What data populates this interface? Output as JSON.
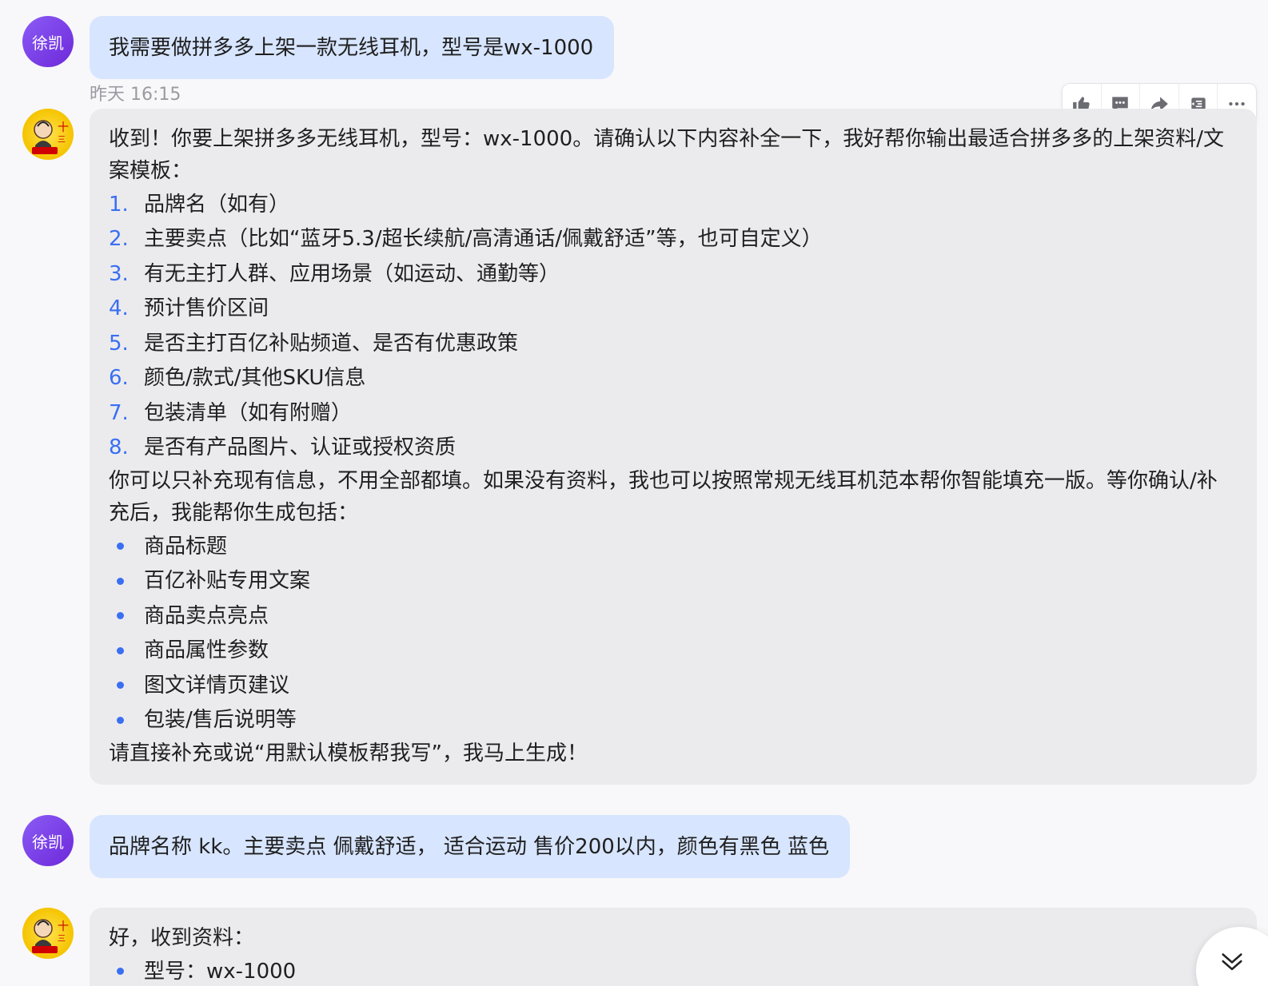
{
  "messages": {
    "m1": {
      "sender": "徐凯",
      "text": "我需要做拼多多上架一款无线耳机，型号是wx-1000"
    },
    "timestamp": "昨天 16:15",
    "m2": {
      "intro": "收到！你要上架拼多多无线耳机，型号：wx-1000。请确认以下内容补全一下，我好帮你输出最适合拼多多的上架资料/文案模板：",
      "numbered": [
        {
          "n": "1.",
          "t": "品牌名（如有）"
        },
        {
          "n": "2.",
          "t": "主要卖点（比如“蓝牙5.3/超长续航/高清通话/佩戴舒适”等，也可自定义）"
        },
        {
          "n": "3.",
          "t": "有无主打人群、应用场景（如运动、通勤等）"
        },
        {
          "n": "4.",
          "t": "预计售价区间"
        },
        {
          "n": "5.",
          "t": "是否主打百亿补贴频道、是否有优惠政策"
        },
        {
          "n": "6.",
          "t": "颜色/款式/其他SKU信息"
        },
        {
          "n": "7.",
          "t": "包装清单（如有附赠）"
        },
        {
          "n": "8.",
          "t": "是否有产品图片、认证或授权资质"
        }
      ],
      "middle": "你可以只补充现有信息，不用全部都填。如果没有资料，我也可以按照常规无线耳机范本帮你智能填充一版。等你确认/补充后，我能帮你生成包括：",
      "bullets": [
        "商品标题",
        "百亿补贴专用文案",
        "商品卖点亮点",
        "商品属性参数",
        "图文详情页建议",
        "包装/售后说明等"
      ],
      "outro": "请直接补充或说“用默认模板帮我写”，我马上生成！"
    },
    "m3": {
      "sender": "徐凯",
      "text": "品牌名称 kk。主要卖点 佩戴舒适， 适合运动 售价200以内，颜色有黑色 蓝色"
    },
    "m4": {
      "intro": "好，收到资料：",
      "bullets": [
        "型号：wx-1000"
      ]
    }
  },
  "toolbar": {
    "icons": [
      "thumbs-up-icon",
      "comment-icon",
      "share-icon",
      "quote-icon",
      "more-icon"
    ]
  },
  "colors": {
    "user_bubble": "#d7e5ff",
    "bot_bubble": "#ebebee",
    "accent": "#3a6ff2",
    "avatar_user": "#7c3aed",
    "avatar_bot": "#f5c400"
  }
}
